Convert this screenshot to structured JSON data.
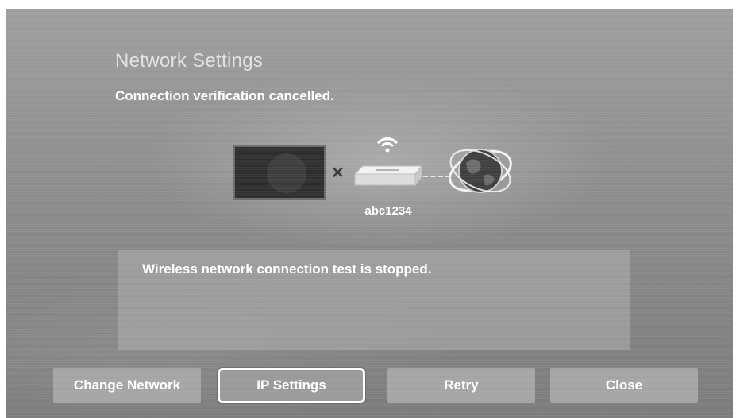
{
  "header": {
    "title": "Network Settings",
    "status": "Connection verification cancelled."
  },
  "diagram": {
    "ssid": "abc1234",
    "connection_state": "failed",
    "icons": [
      "tv-icon",
      "disconnect-x-icon",
      "wifi-signal-icon",
      "router-icon",
      "internet-globe-icon"
    ]
  },
  "message": {
    "text": "Wireless network connection test is stopped."
  },
  "buttons": {
    "change_network": "Change Network",
    "ip_settings": "IP Settings",
    "retry": "Retry",
    "close": "Close",
    "focused": "IP Settings"
  }
}
